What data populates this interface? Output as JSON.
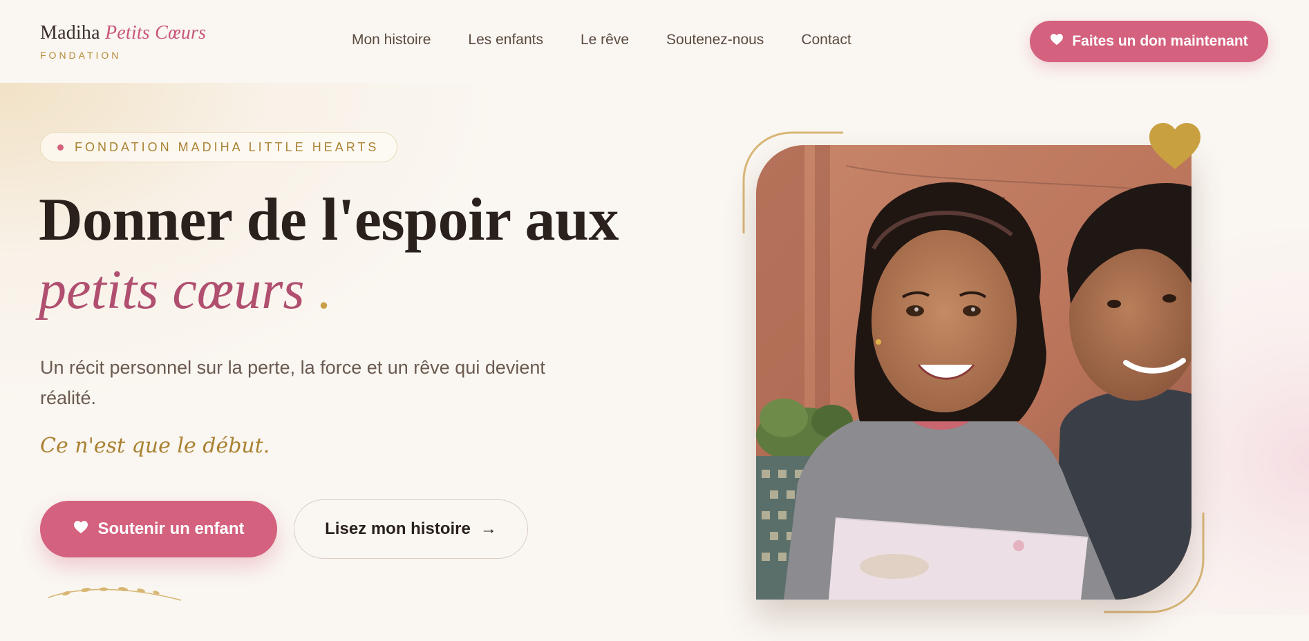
{
  "brand": {
    "name_plain": "Madiha",
    "name_accent": "Petits Cœurs",
    "sub": "FONDATION"
  },
  "nav": {
    "items": [
      "Mon histoire",
      "Les enfants",
      "Le rêve",
      "Soutenez-nous",
      "Contact"
    ]
  },
  "header": {
    "donate_label": "Faites un don maintenant"
  },
  "hero": {
    "badge": "FONDATION MADIHA LITTLE HEARTS",
    "headline_line1": "Donner de l'espoir aux",
    "headline_line2": "petits cœurs",
    "headline_dot": ".",
    "subtitle": "Un récit personnel sur la perte, la force et un rêve qui devient réalité.",
    "tagline": "Ce n'est que le début.",
    "primary_cta": "Soutenir un enfant",
    "secondary_cta": "Lisez mon histoire",
    "secondary_arrow": "→"
  },
  "icons": {
    "heart": "heart-icon",
    "arrow": "arrow-right-icon",
    "gold_heart": "heart-badge-icon"
  },
  "colors": {
    "background": "#faf6f1",
    "primary_pink": "#d4617e",
    "deep_rose": "#b04f6f",
    "gold": "#c9a04a",
    "text_dark": "#2a211c"
  }
}
